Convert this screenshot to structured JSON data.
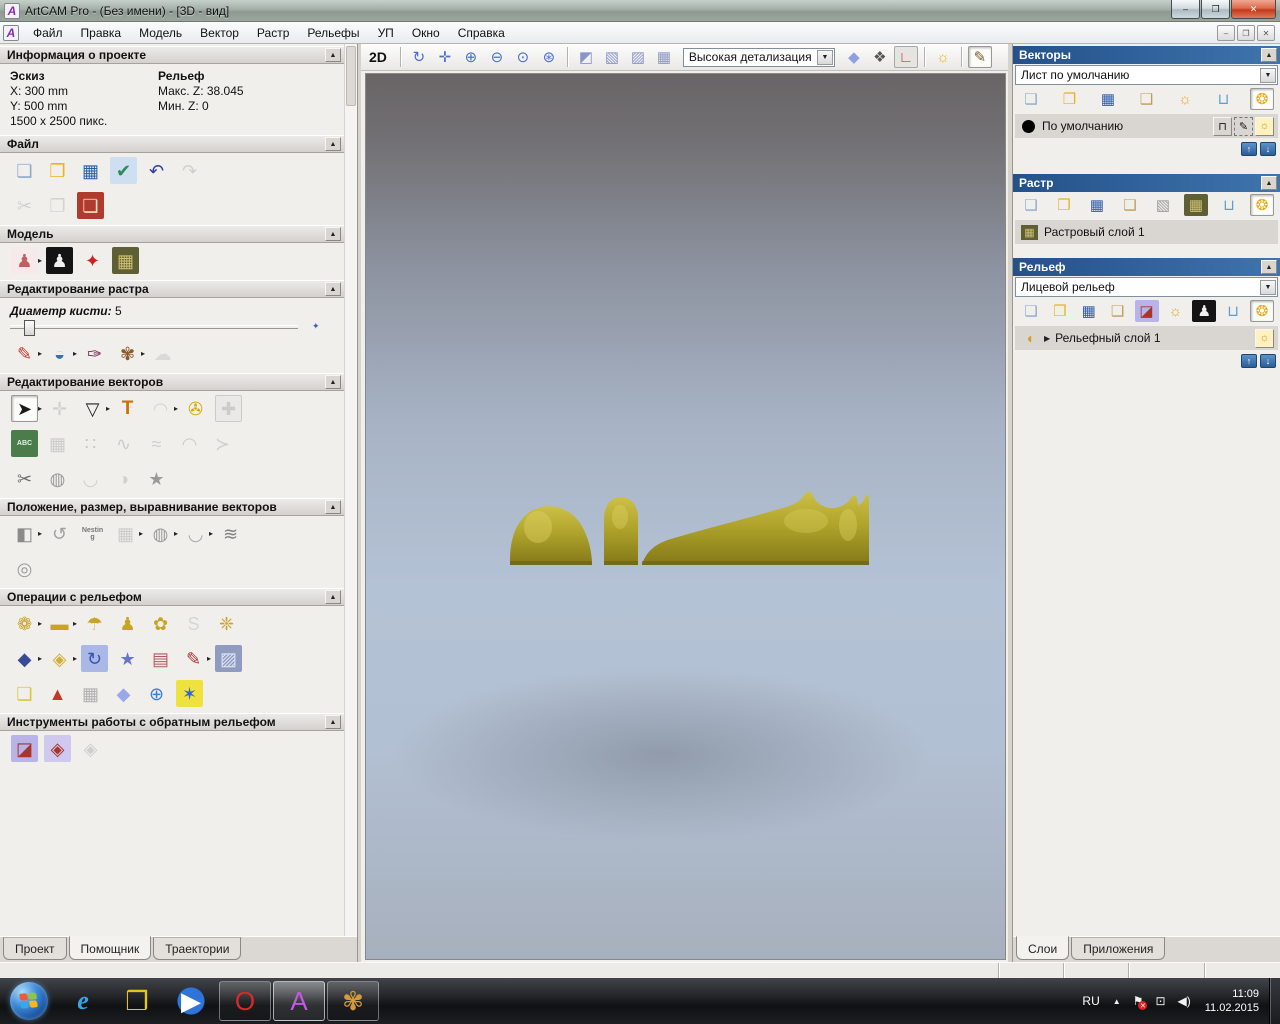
{
  "window": {
    "title": "ArtCAM Pro - (Без имени) - [3D - вид]",
    "icon_glyph": "A",
    "buttons": {
      "minimize": "–",
      "restore": "❐",
      "close": "✕"
    }
  },
  "menu": {
    "items": [
      {
        "id": "file",
        "label": "Файл"
      },
      {
        "id": "edit",
        "label": "Правка"
      },
      {
        "id": "model",
        "label": "Модель"
      },
      {
        "id": "vector",
        "label": "Вектор"
      },
      {
        "id": "raster",
        "label": "Растр"
      },
      {
        "id": "reliefs",
        "label": "Рельефы"
      },
      {
        "id": "toolpaths",
        "label": "УП"
      },
      {
        "id": "window",
        "label": "Окно"
      },
      {
        "id": "help",
        "label": "Справка"
      }
    ]
  },
  "ui": {
    "collapse": "▲",
    "dropdown_arrow": "▼",
    "up": "↑",
    "down": "↓",
    "expand": "▶",
    "flyout": "▸",
    "diamond": "✦",
    "lock": "⊓",
    "pen": "✎",
    "bulb": "☼",
    "relief_layer_glyph": "◖"
  },
  "assistant": {
    "info": {
      "title": "Информация о проекте",
      "sketch_heading": "Эскиз",
      "x": "X: 300 mm",
      "y": "Y: 500 mm",
      "pixels": "1500 x 2500 пикс.",
      "relief_heading": "Рельеф",
      "zmax": "Макс. Z: 38.045",
      "zmin": "Мин. Z: 0"
    },
    "file_section": {
      "title": "Файл",
      "row1": [
        {
          "n": "new-model",
          "g": "❏",
          "c": "#8fa8cc"
        },
        {
          "n": "open-model",
          "g": "❒",
          "c": "#e8b41d"
        },
        {
          "n": "save-model",
          "g": "▦",
          "c": "#2a5caa"
        },
        {
          "n": "import-template",
          "g": "✔",
          "c": "#2e8b57",
          "bg": "#cfdff2"
        },
        {
          "n": "undo",
          "g": "↶",
          "c": "#2a3f9e"
        },
        {
          "n": "redo",
          "g": "↷",
          "c": "#b0b0b0",
          "d": true
        }
      ],
      "row2": [
        {
          "n": "cut",
          "g": "✂",
          "c": "#b0b0b0",
          "d": true
        },
        {
          "n": "copy",
          "g": "❐",
          "c": "#b8b8b8",
          "d": true
        },
        {
          "n": "paste",
          "g": "❏",
          "c": "#f0e0c0",
          "bg": "#b03a2e"
        }
      ]
    },
    "model_section": {
      "title": "Модель",
      "row1": [
        {
          "n": "set-model-size",
          "g": "♟",
          "c": "#c06060",
          "bg": "#f6e9e9",
          "a": true
        },
        {
          "n": "invert-model",
          "g": "♟",
          "c": "#f0f0f0",
          "bg": "#141414"
        },
        {
          "n": "lighting-setup",
          "g": "✦",
          "c": "#cc2222"
        },
        {
          "n": "load-reference-image",
          "g": "▦",
          "c": "#cfc070",
          "bg": "#5f5f35"
        }
      ]
    },
    "raster_section": {
      "title": "Редактирование растра",
      "brush_label": "Диаметр кисти:",
      "brush_value": "5",
      "row1": [
        {
          "n": "paint-tool",
          "g": "✎",
          "c": "#c0392b",
          "a": true
        },
        {
          "n": "flood-fill-tool",
          "g": "◒",
          "c": "#3a6fb0",
          "a": true
        },
        {
          "n": "color-picker-tool",
          "g": "✑",
          "c": "#7a2a5a"
        },
        {
          "n": "palette-tool",
          "g": "✾",
          "c": "#8a5a2a",
          "a": true
        },
        {
          "n": "clear-raster-tool",
          "g": "☁",
          "c": "#c4c4c4",
          "d": true
        }
      ]
    },
    "vector_section": {
      "title": "Редактирование векторов",
      "row1": [
        {
          "n": "select-vectors-tool",
          "g": "➤",
          "c": "#1a1a1a",
          "sel": true,
          "a": true
        },
        {
          "n": "transform-vectors-tool",
          "g": "✛",
          "c": "#b0b0b0",
          "d": true
        },
        {
          "n": "node-editing-tool",
          "g": "▽",
          "c": "#222222",
          "a": true
        },
        {
          "n": "create-text-tool",
          "g": "T",
          "c": "#d07000",
          "cls": "boldg"
        },
        {
          "n": "wrap-text-tool",
          "g": "◠",
          "c": "#b8b8b8",
          "d": true,
          "a": true
        },
        {
          "n": "measure-tool",
          "g": "✇",
          "c": "#d1a500"
        },
        {
          "n": "add-clipart-button",
          "g": "✚",
          "c": "#a8a8a8",
          "d": true,
          "cls": "btn"
        }
      ],
      "row2": [
        {
          "n": "text-along-curve-tool",
          "g": "ABC",
          "bg": "#4a7d4a",
          "c": "#e6f2e6",
          "s": true
        },
        {
          "n": "distort-vectors-tool",
          "g": "▦",
          "c": "#a8a8a8",
          "d": true
        },
        {
          "n": "paste-along-curve-tool",
          "g": "∷",
          "c": "#a0a0a0",
          "d": true
        },
        {
          "n": "fit-polyline-tool",
          "g": "∿",
          "c": "#a8a8a8",
          "d": true
        },
        {
          "n": "sketch-polyline-tool",
          "g": "≈",
          "c": "#b0b0b0",
          "d": true
        },
        {
          "n": "fit-arcs-tool",
          "g": "◠",
          "c": "#a8a8a8",
          "d": true
        },
        {
          "n": "fit-arrow-tool",
          "g": "≻",
          "c": "#b0b0b0",
          "d": true
        }
      ],
      "row3": [
        {
          "n": "trim-vectors-tool",
          "g": "✂",
          "c": "#6a6a6a"
        },
        {
          "n": "create-vector-boundary-tool",
          "g": "◍",
          "c": "#9a9a9a"
        },
        {
          "n": "bend-vectors-tool",
          "g": "◡",
          "c": "#b0b0b0",
          "d": true
        },
        {
          "n": "mirror-merge-tool",
          "g": "◑",
          "c": "#b0b0b0",
          "d": true
        },
        {
          "n": "vector-doctor-tool",
          "g": "★",
          "c": "#9a9a9a"
        }
      ]
    },
    "position_section": {
      "title": "Положение, размер, выравнивание векторов",
      "row1": [
        {
          "n": "align-vectors-tool",
          "g": "◧",
          "c": "#8a8a8a",
          "a": true
        },
        {
          "n": "paste-around-circle-tool",
          "g": "↺",
          "c": "#a0a0a0"
        },
        {
          "n": "nesting-tool",
          "g": "Nesting",
          "c": "#777777",
          "s": true
        },
        {
          "n": "block-copy-tool",
          "g": "▦",
          "c": "#a8a8a8",
          "d": true,
          "a": true
        },
        {
          "n": "weld-vectors-tool",
          "g": "◍",
          "c": "#9a9a9a",
          "a": true
        },
        {
          "n": "fit-vectors-tool",
          "g": "◡",
          "c": "#a8a8a8",
          "a": true
        },
        {
          "n": "wave-distort-tool",
          "g": "≋",
          "c": "#808080"
        }
      ],
      "row2": [
        {
          "n": "spiral-tool",
          "g": "◎",
          "c": "#9a9a9a"
        }
      ]
    },
    "reliefops_section": {
      "title": "Операции с рельефом",
      "row1": [
        {
          "n": "sculpting-tool",
          "g": "❁",
          "c": "#c9a227",
          "a": true
        },
        {
          "n": "add-plane-tool",
          "g": "▬",
          "c": "#c9a227",
          "a": true
        },
        {
          "n": "smooth-relief-tool",
          "g": "☂",
          "c": "#c9a227"
        },
        {
          "n": "dome-relief-tool",
          "g": "♟",
          "c": "#c9a227"
        },
        {
          "n": "scale-relief-tool",
          "g": "✿",
          "c": "#c9a227"
        },
        {
          "n": "smart-engraving-tool",
          "g": "S",
          "c": "#bdbdbd",
          "d": true
        },
        {
          "n": "weave-wizard-tool",
          "g": "❈",
          "c": "#c9a227"
        }
      ],
      "row2": [
        {
          "n": "relief-envelope-tool",
          "g": "◆",
          "c": "#3a4a9a",
          "a": true
        },
        {
          "n": "scale-relief-height-tool",
          "g": "◈",
          "c": "#d4af37",
          "a": true
        },
        {
          "n": "copy-relief-tool",
          "g": "↻",
          "c": "#3355aa",
          "bg": "#aab8e8"
        },
        {
          "n": "texture-star-tool",
          "g": "★",
          "c": "#6a74c8"
        },
        {
          "n": "unwrap-relief-tool",
          "g": "▤",
          "c": "#b05a5a"
        },
        {
          "n": "carve-relief-tool",
          "g": "✎",
          "c": "#a83333",
          "a": true
        },
        {
          "n": "texture-relief-tool",
          "g": "▨",
          "c": "#e0e6f5",
          "bg": "#8f9cc0"
        }
      ],
      "row3": [
        {
          "n": "create-layers-tool",
          "g": "❏",
          "c": "#d8c83a"
        },
        {
          "n": "drape-relief-tool",
          "g": "▲",
          "c": "#c0392b"
        },
        {
          "n": "fade-relief-tool",
          "g": "▦",
          "c": "#b0b0b0"
        },
        {
          "n": "offset-relief-tool",
          "g": "◆",
          "c": "#98a8e8"
        },
        {
          "n": "wrap-sphere-tool",
          "g": "⊕",
          "c": "#3a7fd4"
        },
        {
          "n": "wrap-relief-tool",
          "g": "✶",
          "c": "#3366cc",
          "bg": "#f0e23e"
        }
      ]
    },
    "inverse_section": {
      "title": "Инструменты работы с обратным рельефом",
      "row1": [
        {
          "n": "stamp-inverse-tool",
          "g": "◪",
          "c": "#a8352a",
          "bg": "#b8b4e8"
        },
        {
          "n": "inverse-relief-tool",
          "g": "◈",
          "c": "#a8352a",
          "bg": "#cfc9f0"
        },
        {
          "n": "inverse-relief-gray-tool",
          "g": "◈",
          "c": "#b0b0b0",
          "d": true
        }
      ]
    },
    "tabs": [
      {
        "id": "project",
        "label": "Проект"
      },
      {
        "id": "assistant",
        "label": "Помощник",
        "active": true
      },
      {
        "id": "toolpaths",
        "label": "Траектории"
      }
    ]
  },
  "viewport": {
    "mode_label": "2D",
    "detail_value": "Высокая детализация",
    "toolbar_left": [
      {
        "n": "rotate-view",
        "g": "↻",
        "c": "#4a6fd0"
      },
      {
        "n": "pan-view",
        "g": "✛",
        "c": "#4a6fd0"
      },
      {
        "n": "zoom-in",
        "g": "⊕",
        "c": "#4a6fd0"
      },
      {
        "n": "zoom-out",
        "g": "⊖",
        "c": "#4a6fd0"
      },
      {
        "n": "zoom-previous",
        "g": "⊙",
        "c": "#4a6fd0"
      },
      {
        "n": "zoom-fit",
        "g": "⊛",
        "c": "#4a6fd0"
      },
      {
        "sep": true
      },
      {
        "n": "view-shaded",
        "g": "◩",
        "c": "#8a94c8"
      },
      {
        "n": "view-shaded-wireframe",
        "g": "▧",
        "c": "#8a94c8"
      },
      {
        "n": "view-wireframe",
        "g": "▨",
        "c": "#8a94c8"
      },
      {
        "n": "view-wireframe-hidden",
        "g": "▦",
        "c": "#8a94c8"
      }
    ],
    "toolbar_right": [
      {
        "n": "toggle-draft-plane",
        "g": "◆",
        "c": "#8f9fe0"
      },
      {
        "n": "toggle-mesh",
        "g": "❖",
        "c": "#555555"
      },
      {
        "n": "toggle-origin",
        "g": "∟",
        "c": "#cc3333",
        "cls": "btn"
      },
      {
        "sep": true
      },
      {
        "n": "toggle-light",
        "g": "☼",
        "c": "#e8b41d"
      },
      {
        "sep": true
      },
      {
        "n": "material-settings",
        "g": "✎",
        "c": "#7a5a2a",
        "sel": true
      }
    ]
  },
  "layers": {
    "vectors": {
      "title": "Векторы",
      "sheet_value": "Лист по умолчанию",
      "toolbar": [
        {
          "n": "vectors-new-sheet",
          "g": "❏",
          "c": "#8fa8cc"
        },
        {
          "n": "vectors-open",
          "g": "❒",
          "c": "#e8b41d"
        },
        {
          "n": "vectors-save",
          "g": "▦",
          "c": "#2a5caa"
        },
        {
          "n": "vectors-import",
          "g": "❑",
          "c": "#c09a5a"
        },
        {
          "n": "vectors-new-layer",
          "g": "☼",
          "c": "#e8a81d"
        },
        {
          "n": "vectors-delete-layer",
          "g": "⊔",
          "c": "#5a9fd4"
        },
        {
          "n": "vectors-toggle-all",
          "g": "❂",
          "c": "#e8a81d",
          "sel": true
        }
      ],
      "layer_name": "По умолчанию"
    },
    "raster": {
      "title": "Растр",
      "toolbar": [
        {
          "n": "raster-new",
          "g": "❏",
          "c": "#8fa8cc"
        },
        {
          "n": "raster-open",
          "g": "❒",
          "c": "#e8b41d"
        },
        {
          "n": "raster-save",
          "g": "▦",
          "c": "#2a5caa"
        },
        {
          "n": "raster-import",
          "g": "❑",
          "c": "#c09a5a"
        },
        {
          "n": "raster-grayscale",
          "g": "▧",
          "c": "#9a9a9a"
        },
        {
          "n": "raster-from-image",
          "g": "▦",
          "c": "#cfc070",
          "bg": "#5f5f35"
        },
        {
          "n": "raster-delete-layer",
          "g": "⊔",
          "c": "#5a9fd4"
        },
        {
          "n": "raster-toggle-all",
          "g": "❂",
          "c": "#e8a81d",
          "sel": true
        }
      ],
      "layer_name": "Растровый слой 1"
    },
    "relief": {
      "title": "Рельеф",
      "dropdown_value": "Лицевой рельеф",
      "toolbar": [
        {
          "n": "relief-new",
          "g": "❏",
          "c": "#8fa8cc"
        },
        {
          "n": "relief-open",
          "g": "❒",
          "c": "#e8b41d"
        },
        {
          "n": "relief-save",
          "g": "▦",
          "c": "#2a5caa"
        },
        {
          "n": "relief-import",
          "g": "❑",
          "c": "#c09a5a"
        },
        {
          "n": "relief-stamp",
          "g": "◪",
          "c": "#a8352a",
          "bg": "#b8b4e8"
        },
        {
          "n": "relief-new-layer",
          "g": "☼",
          "c": "#e8a81d"
        },
        {
          "n": "relief-from-model",
          "g": "♟",
          "c": "#f0f0f0",
          "bg": "#141414"
        },
        {
          "n": "relief-delete-layer",
          "g": "⊔",
          "c": "#5a9fd4"
        },
        {
          "n": "relief-toggle-all",
          "g": "❂",
          "c": "#e8a81d",
          "sel": true
        }
      ],
      "layer_name": "Рельефный слой 1"
    },
    "tabs": [
      {
        "id": "layers",
        "label": "Слои",
        "active": true
      },
      {
        "id": "applications",
        "label": "Приложения"
      }
    ]
  },
  "taskbar": {
    "apps": [
      {
        "n": "taskbar-ie",
        "g": "e",
        "c": "#35a6e8",
        "cls": "tb-ie"
      },
      {
        "n": "taskbar-explorer",
        "g": "❒",
        "c": "#e8c21d"
      },
      {
        "n": "taskbar-media-player",
        "g": "▶",
        "c": "#ffffff",
        "cls": "tb-round"
      },
      {
        "n": "taskbar-opera",
        "g": "O",
        "c": "#d42a2a",
        "cls": "tb-btn"
      },
      {
        "n": "taskbar-artcam",
        "g": "A",
        "c": "#c05ae0",
        "cls": "tb-btn tb-active"
      },
      {
        "n": "taskbar-paint",
        "g": "✾",
        "c": "#d49a3a",
        "cls": "tb-btn"
      }
    ],
    "tray": {
      "lang": "RU",
      "time": "11:09",
      "date": "11.02.2015"
    },
    "tray_icons": {
      "arrow": "▲",
      "flag": "⚑",
      "alert": "✕",
      "network": "⊡",
      "volume": "◀)"
    }
  }
}
